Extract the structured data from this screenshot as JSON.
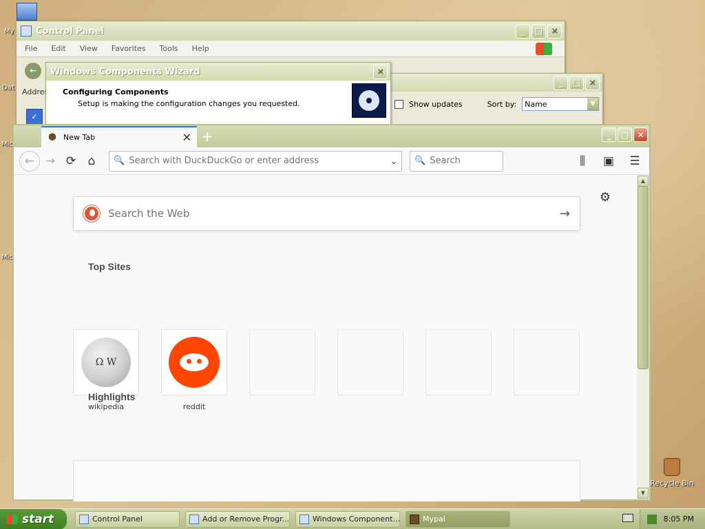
{
  "desktop": {
    "icon_labels": [
      "My",
      "Dat",
      "Mic",
      "Mic"
    ],
    "recycle_bin": "Recycle Bin"
  },
  "control_panel": {
    "title": "Control Panel",
    "menu": [
      "File",
      "Edit",
      "View",
      "Favorites",
      "Tools",
      "Help"
    ],
    "address_label": "Addres"
  },
  "add_remove": {
    "show_updates": "Show updates",
    "sort_by_label": "Sort by:",
    "sort_by_value": "Name"
  },
  "wizard": {
    "title": "Windows Components Wizard",
    "heading": "Configuring Components",
    "subheading": "Setup is making the configuration changes you requested."
  },
  "browser": {
    "tab_title": "New Tab",
    "url_placeholder": "Search with DuckDuckGo or enter address",
    "search_placeholder": "Search",
    "search_web_placeholder": "Search the Web",
    "top_sites_title": "Top Sites",
    "highlights_title": "Highlights",
    "top_sites": [
      {
        "label": "wikipedia"
      },
      {
        "label": "reddit"
      },
      {
        "label": ""
      },
      {
        "label": ""
      },
      {
        "label": ""
      },
      {
        "label": ""
      }
    ]
  },
  "taskbar": {
    "start_label": "start",
    "tasks": [
      "Control Panel",
      "Add or Remove Progr...",
      "Windows Component...",
      "Mypal"
    ],
    "clock": "8:05 PM"
  },
  "colors": {
    "accent_tab": "#0a84ff",
    "reddit": "#ff4500",
    "ddg": "#de5833",
    "start_green": "#3c7f22"
  }
}
